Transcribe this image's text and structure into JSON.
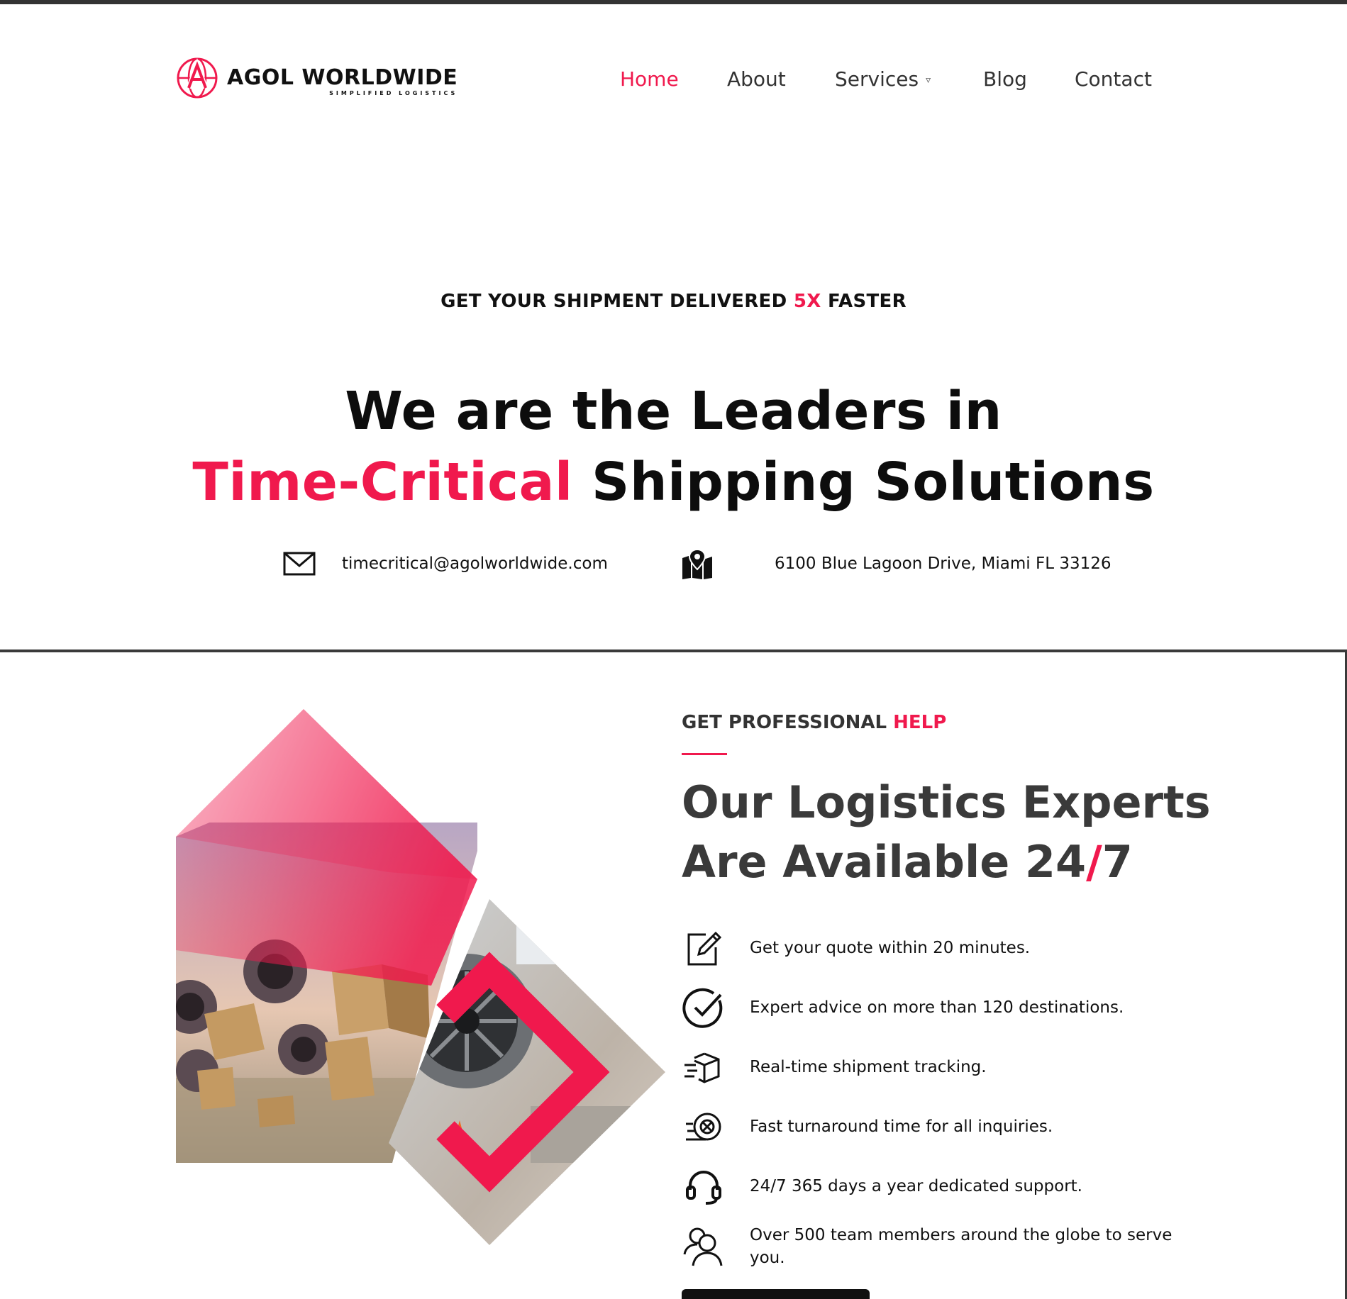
{
  "brand": {
    "name": "AGOL WORLDWIDE",
    "tagline": "SIMPLIFIED LOGISTICS",
    "accent_color": "#f0194d"
  },
  "nav": {
    "items": [
      {
        "label": "Home",
        "active": true
      },
      {
        "label": "About",
        "active": false
      },
      {
        "label": "Services",
        "active": false,
        "has_dropdown": true,
        "dropdown_icon": "chevron-down-icon"
      },
      {
        "label": "Blog",
        "active": false
      },
      {
        "label": "Contact",
        "active": false
      }
    ]
  },
  "hero": {
    "eyebrow_before": "GET YOUR SHIPMENT DELIVERED ",
    "eyebrow_accent": "5X",
    "eyebrow_after": " FASTER",
    "title_line1": "We are the Leaders in",
    "title_accent": "Time-Critical",
    "title_line2_rest": " Shipping Solutions",
    "email": "timecritical@agolworldwide.com",
    "email_icon": "envelope-icon",
    "address": "6100 Blue Lagoon Drive, Miami FL 33126",
    "address_icon": "map-pin-icon"
  },
  "help": {
    "kicker_before": "GET PROFESSIONAL ",
    "kicker_accent": "HELP",
    "heading_line1": "Our Logistics Experts",
    "heading_line2_before": "Are Available 24",
    "heading_slash": "/",
    "heading_line2_after": "7",
    "features": [
      {
        "icon": "edit-icon",
        "text": "Get your quote within 20 minutes."
      },
      {
        "icon": "check-circle-icon",
        "text": "Expert advice on more than 120 destinations."
      },
      {
        "icon": "fast-box-icon",
        "text": "Real-time shipment tracking."
      },
      {
        "icon": "fast-turnaround-icon",
        "text": "Fast turnaround time for all inquiries."
      },
      {
        "icon": "headset-icon",
        "text": "24/7 365 days a year dedicated support."
      },
      {
        "icon": "team-icon",
        "text": "Over 500 team members around the globe to serve you."
      }
    ]
  }
}
